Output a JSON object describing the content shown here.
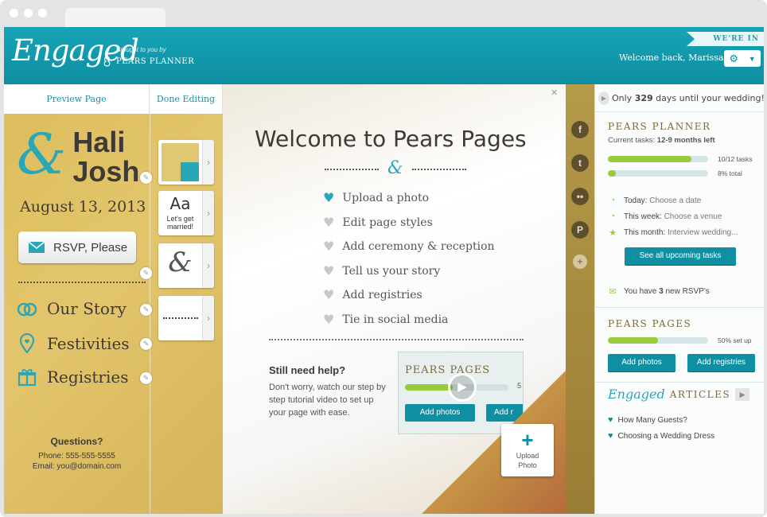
{
  "app": {
    "logo": "Engaged",
    "brought_by": "Brought to you by",
    "partner": "PEARS PLANNER",
    "beta_badge": "WE'RE IN BETA",
    "welcome": "Welcome back, Marissa"
  },
  "left": {
    "tabs": [
      "Preview Page",
      "Done Editing"
    ],
    "names_line1": "Hali",
    "names_line2": "Josh",
    "date": "August 13, 2013",
    "rsvp": "RSVP, Please",
    "nav": [
      "Our Story",
      "Festivities",
      "Registries"
    ],
    "questions_title": "Questions?",
    "phone": "Phone: 555-555-5555",
    "email": "Email: you@domain.com",
    "thumbs": {
      "font_sample": "Aa",
      "font_caption": "Let's get married!"
    }
  },
  "center": {
    "title": "Welcome to Pears Pages",
    "checklist": [
      "Upload a photo",
      "Edit page styles",
      "Add ceremony & reception",
      "Tell us your story",
      "Add registries",
      "Tie in social media"
    ],
    "checklist_done": [
      true,
      false,
      false,
      false,
      false,
      false
    ],
    "help_title": "Still need help?",
    "help_text": "Don't worry, watch our step by step tutorial video to set up your page with ease.",
    "video": {
      "title": "PEARS PAGES",
      "btn1": "Add photos",
      "btn2": "Add r",
      "pct": "5"
    },
    "upload": {
      "line1": "Upload",
      "line2": "Photo"
    }
  },
  "social": [
    "facebook-icon",
    "twitter-icon",
    "flickr-icon",
    "pinterest-icon",
    "add-icon"
  ],
  "right": {
    "days_pre": "Only ",
    "days_num": "329",
    "days_post": " days until your wedding!",
    "planner_title": "PEARS PLANNER",
    "current_tasks": "Current tasks: ",
    "current_tasks_range": "12-9 months left",
    "bar1": {
      "label": "10/12 tasks",
      "fraction": 0.83
    },
    "bar2": {
      "label": "8% total",
      "fraction": 0.08
    },
    "tasks": [
      {
        "when": "Today:",
        "what": "Choose a date"
      },
      {
        "when": "This week:",
        "what": "Choose a venue"
      },
      {
        "when": "This month:",
        "what": "Interview wedding..."
      }
    ],
    "see_all": "See all upcoming tasks",
    "rsvp_pre": "You have ",
    "rsvp_num": "3",
    "rsvp_post": " new RSVP's",
    "pages_title": "PEARS PAGES",
    "pages_bar": {
      "label": "50% set up",
      "fraction": 0.5
    },
    "add_photos": "Add photos",
    "add_registries": "Add registries",
    "articles_logo": "Engaged",
    "articles_title": "ARTICLES",
    "articles": [
      "How Many Guests?",
      "Choosing a Wedding Dress"
    ]
  },
  "colors": {
    "teal": "#0f8fa2",
    "gold": "#dcbd5c",
    "green": "#9acb3c"
  }
}
